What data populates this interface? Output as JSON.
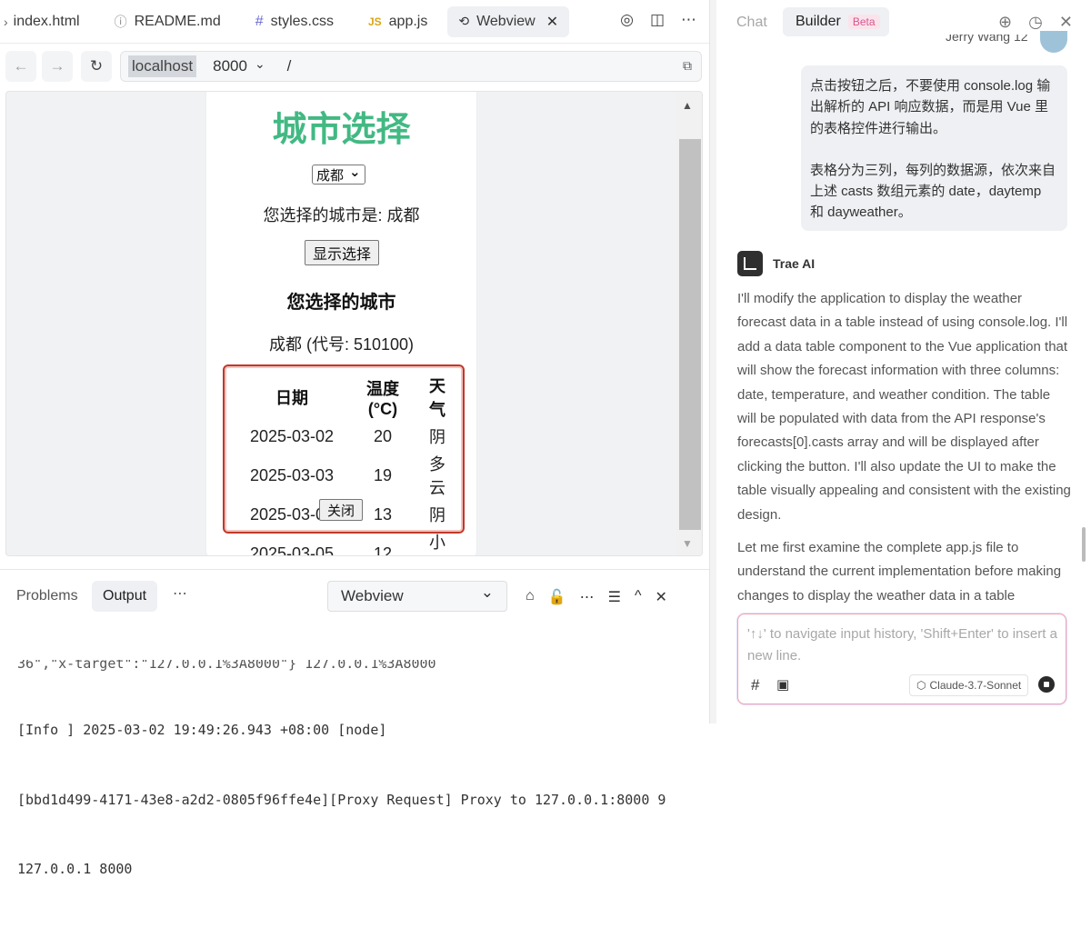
{
  "editor_tabs": [
    {
      "label": "index.html",
      "icon": "chevron-right-icon"
    },
    {
      "label": "README.md",
      "icon": "info-circle-icon"
    },
    {
      "label": "styles.css",
      "icon": "hash-icon"
    },
    {
      "label": "app.js",
      "icon": "js-file-icon"
    },
    {
      "label": "Webview",
      "icon": "webview-icon",
      "active": true
    }
  ],
  "tab_glyphs": {
    "readme": "ⓘ",
    "css": "#",
    "js": "JS",
    "webview": "⟲",
    "close": "✕"
  },
  "tab_tools": {
    "compass": "◎",
    "split": "◫",
    "more": "⋯"
  },
  "browser": {
    "back": "←",
    "forward": "→",
    "reload": "↻",
    "host": "localhost",
    "port": "8000",
    "port_arrow": "⌄",
    "path": "/",
    "copy": "⧉"
  },
  "page": {
    "title": "城市选择",
    "select_value": "成都",
    "select_arrow": "⌄",
    "selected_text": "您选择的城市是: 成都",
    "show_button": "显示选择",
    "heading": "您选择的城市",
    "city_line": "成都 (代号: 510100)",
    "table_headers": [
      "日期",
      "温度 (°C)",
      "天气"
    ],
    "table_rows": [
      [
        "2025-03-02",
        "20",
        "阴"
      ],
      [
        "2025-03-03",
        "19",
        "多云"
      ],
      [
        "2025-03-04",
        "13",
        "阴"
      ],
      [
        "2025-03-05",
        "12",
        "小雨"
      ]
    ],
    "close_button": "关闭",
    "scroll_up": "▲",
    "scroll_down": "▼"
  },
  "panel": {
    "tabs": [
      "Problems",
      "Output"
    ],
    "active_tab": "Output",
    "more": "⋯",
    "channel": "Webview",
    "channel_arrow": "⌄",
    "tools": [
      "⌂",
      "🔓",
      "⋯",
      "☰",
      "^",
      "✕"
    ],
    "log_lines": [
      "36\",\"x-target\":\"127.0.0.1%3A8000\"} 127.0.0.1%3A8000",
      "[Info ] 2025-03-02 19:49:26.943 +08:00 [node]",
      "[bbd1d499-4171-43e8-a2d2-0805f96ffe4e][Proxy Request] Proxy to 127.0.0.1:8000 9",
      "127.0.0.1 8000"
    ]
  },
  "assistant": {
    "tab_chat": "Chat",
    "tab_builder": "Builder",
    "beta": "Beta",
    "tools": [
      "⊕",
      "◷",
      "✕"
    ],
    "user_name": "Jerry Wang 12",
    "user_message": [
      "点击按钮之后，不要使用 console.log 输出解析的 API 响应数据，而是用 Vue 里的表格控件进行输出。",
      "表格分为三列，每列的数据源，依次来自上述 casts 数组元素的 date，daytemp 和 dayweather。"
    ],
    "ai_name": "Trae AI",
    "ai_paragraphs": [
      "I'll modify the application to display the weather forecast data in a table instead of using console.log. I'll add a data table component to the Vue application that will show the forecast information with three columns: date, temperature, and weather condition. The table will be populated with data from the API response's forecasts[0].casts array and will be displayed after clicking the button. I'll also update the UI to make the table visually appealing and consistent with the existing design.",
      "Let me first examine the complete app.js file to understand the current implementation before making changes to display the weather data in a table"
    ],
    "input_placeholder": "'↑↓' to navigate input history, 'Shift+Enter' to insert a new line.",
    "hash": "#",
    "image": "▣",
    "model_icon": "⬡",
    "model": "Claude-3.7-Sonnet"
  },
  "colors": {
    "vue_green": "#42b983",
    "table_border": "#c0392b",
    "beta_pink": "#d6578c"
  }
}
